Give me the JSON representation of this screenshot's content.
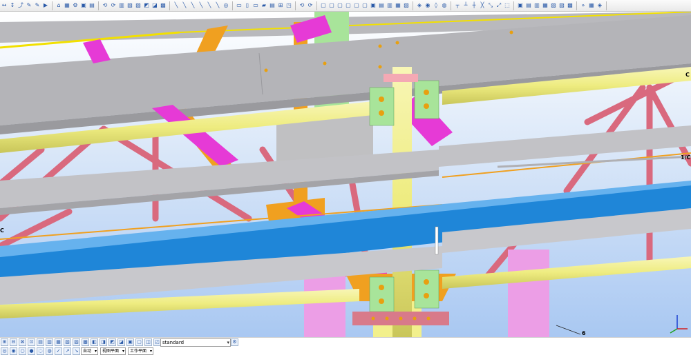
{
  "toolbar": {
    "groups": [
      [
        "↔",
        "↕",
        "⤴",
        "✎",
        "✎",
        "▶"
      ],
      [
        "⌂",
        "▦",
        "⚙",
        "▣",
        "▤"
      ],
      [
        "⟲",
        "⟳",
        "▥",
        "▧",
        "▨",
        "◩",
        "◪",
        "▩"
      ],
      [
        "╲",
        "╲",
        "╲",
        "╲",
        "╲",
        "╲",
        "◎"
      ],
      [
        "▭",
        "▯",
        "▭",
        "▰",
        "▤",
        "⊞",
        "◳"
      ],
      [
        "⟲",
        "⟳"
      ],
      [
        "▢",
        "▢",
        "▢",
        "▢",
        "▢",
        "▢",
        "▣",
        "▤",
        "▥",
        "▦",
        "▧"
      ],
      [
        "◈",
        "◉",
        "◊",
        "◍"
      ],
      [
        "┬",
        "┴",
        "┼",
        "╳",
        "⤡",
        "⤢",
        "⬚"
      ],
      [
        "▣",
        "▤",
        "▥",
        "▦",
        "▧",
        "▨",
        "▩"
      ],
      [
        "»",
        "▦",
        "◈"
      ]
    ]
  },
  "viewport": {
    "grid_labels": {
      "c_right": "C",
      "c_left": "C",
      "one_c": "1/C",
      "six": "6"
    }
  },
  "statusbar": {
    "combo_value": "standard",
    "row1_buttons": [
      "⊞",
      "⊟",
      "⊠",
      "⊡",
      "▤",
      "▥",
      "▦",
      "▧",
      "▨",
      "▩",
      "◧",
      "◨",
      "◩",
      "◪",
      "▣",
      "▢",
      "◫",
      "◰",
      "◱",
      "◲",
      "◳",
      "◴",
      "◵",
      "◶",
      "◷"
    ],
    "row2_buttons": [
      "◎",
      "◉",
      "○",
      "●",
      "◌",
      "◍",
      "✓",
      "↗",
      "↘"
    ],
    "selects": [
      {
        "label": "自动"
      },
      {
        "label": "视图平面"
      },
      {
        "label": "工作平面"
      }
    ]
  },
  "colors": {
    "sky_top": "#ffffff",
    "sky_bottom": "#a9c8f2",
    "beam_gray": "#b8b8bc",
    "pipe_yellow": "#f2f08c",
    "brace_pink": "#d9697e",
    "blue_beam": "#1f86d8",
    "magenta": "#e63ad6",
    "orange": "#f0a020",
    "green_plate": "#a8e49a",
    "column_pink": "#ec9ee6"
  }
}
